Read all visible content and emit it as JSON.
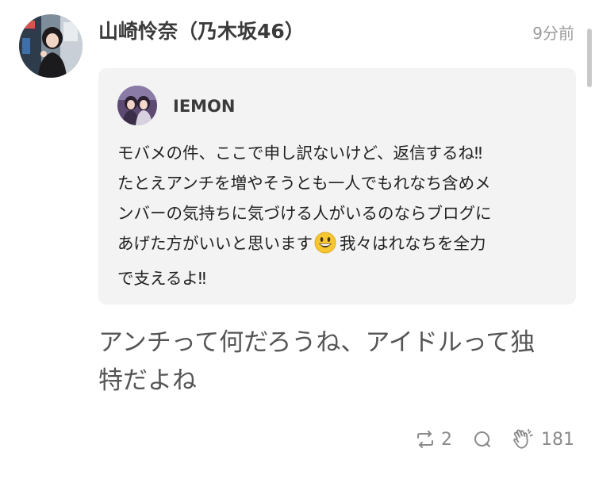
{
  "post": {
    "author_name": "山崎怜奈（乃木坂46）",
    "timestamp": "9分前",
    "avatar_icon": "user-avatar-photo",
    "quote": {
      "author_name": "IEMON",
      "avatar_icon": "user-avatar-photo",
      "text_lines": [
        "モバメの件、ここで申し訳ないけど、返信するね‼",
        "たとえアンチを増やそうとも一人でもれなち含めメ",
        "ンバーの気持ちに気づける人がいるのならブログに",
        "あげた方がいいと思います",
        "我々はれなちを全力",
        "で支えるよ‼"
      ],
      "emoji_icon": "grinning-face-emoji"
    },
    "comment_lines": [
      "アンチって何だろうね、アイドルって独",
      "特だよね"
    ],
    "actions": {
      "repost_count": "2",
      "reply_icon": "comment-bubble-icon",
      "clap_count": "181"
    }
  },
  "colors": {
    "quote_background": "#f3f3f3",
    "muted_text": "#9b9b9b",
    "action_icon": "#8a8a8a"
  }
}
